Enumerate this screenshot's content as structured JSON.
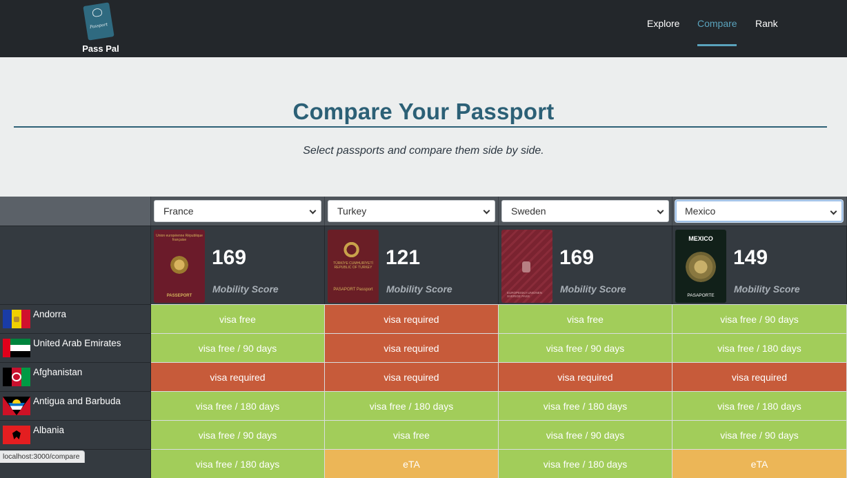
{
  "app": {
    "brand_name": "Pass Pal",
    "logo_text": "Passport"
  },
  "nav": {
    "items": [
      {
        "label": "Explore",
        "active": false
      },
      {
        "label": "Compare",
        "active": true
      },
      {
        "label": "Rank",
        "active": false
      }
    ]
  },
  "hero": {
    "title": "Compare Your Passport",
    "subtitle": "Select passports and compare them side by side."
  },
  "passports": [
    {
      "selected": "France",
      "score": "169",
      "score_label": "Mobility Score",
      "cover_top": "Union européenne République française",
      "cover_bottom": "PASSEPORT",
      "cover_color": "#6b1b2a",
      "emblem_color": "#b8913f",
      "emblem": "french-emblem"
    },
    {
      "selected": "Turkey",
      "score": "121",
      "score_label": "Mobility Score",
      "cover_top": "TÜRKİYE CUMHURİYETİ REPUBLIC OF TURKEY",
      "cover_bottom": "PASAPORT Passport",
      "cover_color": "#6a1e26",
      "emblem_color": "#c9a24a",
      "emblem": "crescent-star"
    },
    {
      "selected": "Sweden",
      "score": "169",
      "score_label": "Mobility Score",
      "cover_top": "",
      "cover_bottom": "EUROPEISKA UNIONEN SVERIGE PASS",
      "cover_color": "#7a2330",
      "emblem_color": "#b77f83",
      "emblem": "swedish-crown"
    },
    {
      "selected": "Mexico",
      "score": "149",
      "score_label": "Mobility Score",
      "cover_top": "MEXICO",
      "cover_bottom": "PASAPORTE",
      "cover_color": "#112019",
      "emblem_color": "#b9a15a",
      "emblem": "mexican-eagle"
    }
  ],
  "rows": [
    {
      "country": "Andorra",
      "flag": "andorra-flag",
      "values": [
        "visa free",
        "visa required",
        "visa free",
        "visa free / 90 days"
      ]
    },
    {
      "country": "United Arab Emirates",
      "flag": "uae-flag",
      "values": [
        "visa free / 90 days",
        "visa required",
        "visa free / 90 days",
        "visa free / 180 days"
      ]
    },
    {
      "country": "Afghanistan",
      "flag": "afghanistan-flag",
      "values": [
        "visa required",
        "visa required",
        "visa required",
        "visa required"
      ]
    },
    {
      "country": "Antigua and Barbuda",
      "flag": "antigua-flag",
      "values": [
        "visa free / 180 days",
        "visa free / 180 days",
        "visa free / 180 days",
        "visa free / 180 days"
      ]
    },
    {
      "country": "Albania",
      "flag": "albania-flag",
      "values": [
        "visa free / 90 days",
        "visa free",
        "visa free / 90 days",
        "visa free / 90 days"
      ]
    },
    {
      "country": "",
      "flag": "",
      "values": [
        "visa free / 180 days",
        "eTA",
        "visa free / 180 days",
        "eTA"
      ]
    }
  ],
  "status_colors": {
    "visa_free": "#a2cd5a",
    "visa_required": "#c75b3a",
    "eta": "#ecb657"
  },
  "statusbar": {
    "url": "localhost:3000/compare"
  }
}
